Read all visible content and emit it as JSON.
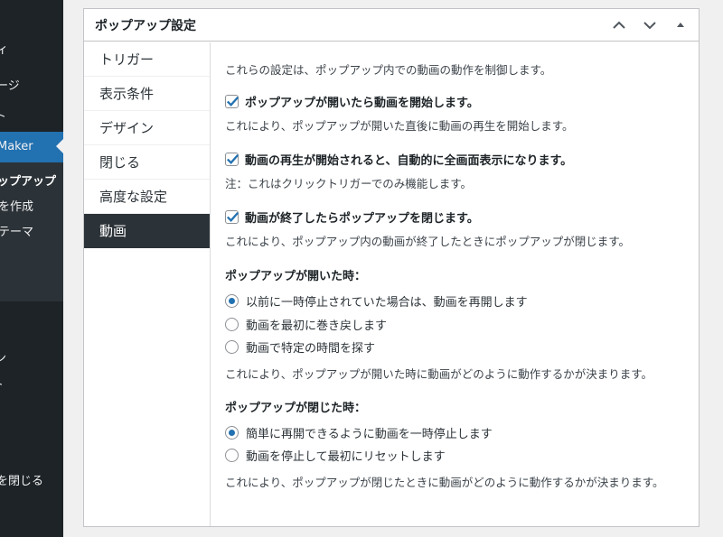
{
  "admin_menu": {
    "items": [
      {
        "label": "ィ"
      },
      {
        "label": "ージ"
      },
      {
        "label": "ト"
      },
      {
        "label": "Maker"
      },
      {
        "label": "ン"
      },
      {
        "label": "ト"
      },
      {
        "label": "を閉じる"
      }
    ],
    "submenu": [
      {
        "label": "ップアップ"
      },
      {
        "label": "を作成"
      },
      {
        "label": "テーマ"
      }
    ],
    "active_color": "#2271b1"
  },
  "postbox": {
    "title": "ポップアップ設定",
    "handle_icons": [
      "chevron-up-icon",
      "chevron-down-icon",
      "triangle-up-icon"
    ]
  },
  "tabs": [
    {
      "label": "トリガー",
      "active": false
    },
    {
      "label": "表示条件",
      "active": false
    },
    {
      "label": "デザイン",
      "active": false
    },
    {
      "label": "閉じる",
      "active": false
    },
    {
      "label": "高度な設定",
      "active": false
    },
    {
      "label": "動画",
      "active": true
    }
  ],
  "panel": {
    "intro": "これらの設定は、ポップアップ内での動画の動作を制御します。",
    "options": [
      {
        "label": "ポップアップが開いたら動画を開始します。",
        "checked": true,
        "description": "これにより、ポップアップが開いた直後に動画の再生を開始します。"
      },
      {
        "label": "動画の再生が開始されると、自動的に全画面表示になります。",
        "checked": true,
        "description": "注：これはクリックトリガーでのみ機能します。"
      },
      {
        "label": "動画が終了したらポップアップを閉じます。",
        "checked": true,
        "description": "これにより、ポップアップ内の動画が終了したときにポップアップが閉じます。"
      }
    ],
    "on_open": {
      "title": "ポップアップが開いた時：",
      "choices": [
        {
          "label": "以前に一時停止されていた場合は、動画を再開します",
          "selected": true
        },
        {
          "label": "動画を最初に巻き戻します",
          "selected": false
        },
        {
          "label": "動画で特定の時間を探す",
          "selected": false
        }
      ],
      "description": "これにより、ポップアップが開いた時に動画がどのように動作するかが決まります。"
    },
    "on_close": {
      "title": "ポップアップが閉じた時：",
      "choices": [
        {
          "label": "簡単に再開できるように動画を一時停止します",
          "selected": true
        },
        {
          "label": "動画を停止して最初にリセットします",
          "selected": false
        }
      ],
      "description": "これにより、ポップアップが閉じたときに動画がどのように動作するかが決まります。"
    }
  },
  "colors": {
    "accent": "#2271b1",
    "sidebar": "#1d2327",
    "active_tab": "#2c3338"
  }
}
